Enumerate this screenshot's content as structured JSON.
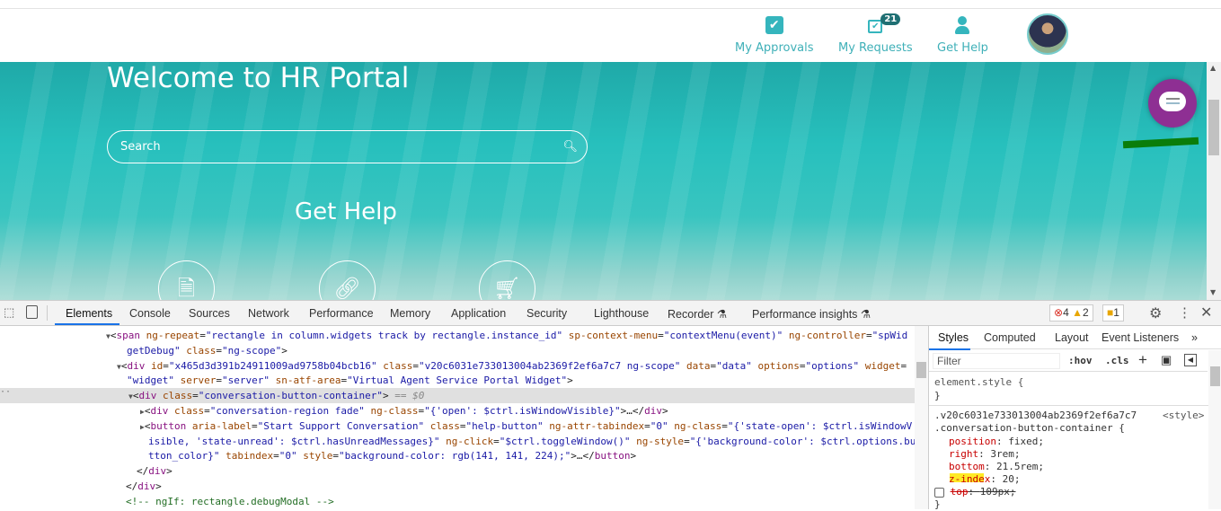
{
  "header": {
    "nav": [
      {
        "label": "My Approvals",
        "icon": "check-square-icon"
      },
      {
        "label": "My Requests",
        "icon": "requests-icon",
        "badge": "21"
      },
      {
        "label": "Get Help",
        "icon": "user-icon"
      }
    ]
  },
  "hero": {
    "title": "Welcome to HR Portal",
    "search_placeholder": "Search",
    "section_title": "Get Help"
  },
  "devtools": {
    "tabs": [
      "Elements",
      "Console",
      "Sources",
      "Network",
      "Performance",
      "Memory",
      "Application",
      "Security",
      "Lighthouse",
      "Recorder",
      "Performance insights"
    ],
    "active_tab": "Elements",
    "errors": "4",
    "warnings": "2",
    "issues": "1",
    "elements_lines": [
      {
        "indent": 118,
        "tri": "▼",
        "segs": [
          [
            "p",
            "<"
          ],
          [
            "t",
            "span "
          ],
          [
            "a",
            "ng-repeat"
          ],
          [
            "p",
            "="
          ],
          [
            "v",
            "\"rectangle in column.widgets track by rectangle.instance_id\" "
          ],
          [
            "a",
            "sp-context-menu"
          ],
          [
            "p",
            "="
          ],
          [
            "v",
            "\"contextMenu(event)\" "
          ],
          [
            "a",
            "ng-controller"
          ],
          [
            "p",
            "="
          ],
          [
            "v",
            "\"spWid"
          ]
        ]
      },
      {
        "indent": 141,
        "tri": "",
        "segs": [
          [
            "v",
            "getDebug\" "
          ],
          [
            "a",
            "class"
          ],
          [
            "p",
            "="
          ],
          [
            "v",
            "\"ng-scope\""
          ],
          [
            "p",
            ">"
          ]
        ]
      },
      {
        "indent": 130,
        "tri": "▼",
        "segs": [
          [
            "p",
            "<"
          ],
          [
            "t",
            "div "
          ],
          [
            "a",
            "id"
          ],
          [
            "p",
            "="
          ],
          [
            "v",
            "\"x465d3d391b24911009ad9758b04bcb16\" "
          ],
          [
            "a",
            "class"
          ],
          [
            "p",
            "="
          ],
          [
            "v",
            "\"v20c6031e733013004ab2369f2ef6a7c7 ng-scope\" "
          ],
          [
            "a",
            "data"
          ],
          [
            "p",
            "="
          ],
          [
            "v",
            "\"data\" "
          ],
          [
            "a",
            "options"
          ],
          [
            "p",
            "="
          ],
          [
            "v",
            "\"options\" "
          ],
          [
            "a",
            "widget"
          ],
          [
            "p",
            "="
          ]
        ]
      },
      {
        "indent": 141,
        "tri": "",
        "segs": [
          [
            "v",
            "\"widget\" "
          ],
          [
            "a",
            "server"
          ],
          [
            "p",
            "="
          ],
          [
            "v",
            "\"server\" "
          ],
          [
            "a",
            "sn-atf-area"
          ],
          [
            "p",
            "="
          ],
          [
            "v",
            "\"Virtual Agent Service Portal Widget\""
          ],
          [
            "p",
            ">"
          ]
        ]
      },
      {
        "indent": 143,
        "tri": "▼",
        "sel": true,
        "segs": [
          [
            "p",
            "<"
          ],
          [
            "t",
            "div "
          ],
          [
            "a",
            "class"
          ],
          [
            "p",
            "="
          ],
          [
            "v",
            "\"conversation-button-container\""
          ],
          [
            "p",
            "> "
          ],
          [
            "s",
            "== $0"
          ]
        ]
      },
      {
        "indent": 156,
        "tri": "▶",
        "segs": [
          [
            "p",
            "<"
          ],
          [
            "t",
            "div "
          ],
          [
            "a",
            "class"
          ],
          [
            "p",
            "="
          ],
          [
            "v",
            "\"conversation-region fade\" "
          ],
          [
            "a",
            "ng-class"
          ],
          [
            "p",
            "="
          ],
          [
            "v",
            "\"{'open': $ctrl.isWindowVisible}\""
          ],
          [
            "p",
            ">…</"
          ],
          [
            "t",
            "div"
          ],
          [
            "p",
            ">"
          ]
        ]
      },
      {
        "indent": 156,
        "tri": "▶",
        "segs": [
          [
            "p",
            "<"
          ],
          [
            "t",
            "button "
          ],
          [
            "a",
            "aria-label"
          ],
          [
            "p",
            "="
          ],
          [
            "v",
            "\"Start Support Conversation\" "
          ],
          [
            "a",
            "class"
          ],
          [
            "p",
            "="
          ],
          [
            "v",
            "\"help-button\" "
          ],
          [
            "a",
            "ng-attr-tabindex"
          ],
          [
            "p",
            "="
          ],
          [
            "v",
            "\"0\" "
          ],
          [
            "a",
            "ng-class"
          ],
          [
            "p",
            "="
          ],
          [
            "v",
            "\"{'state-open': $ctrl.isWindowV"
          ]
        ]
      },
      {
        "indent": 165,
        "tri": "",
        "segs": [
          [
            "v",
            "isible, 'state-unread': $ctrl.hasUnreadMessages}\" "
          ],
          [
            "a",
            "ng-click"
          ],
          [
            "p",
            "="
          ],
          [
            "v",
            "\"$ctrl.toggleWindow()\" "
          ],
          [
            "a",
            "ng-style"
          ],
          [
            "p",
            "="
          ],
          [
            "v",
            "\"{'background-color': $ctrl.options.bu"
          ]
        ]
      },
      {
        "indent": 165,
        "tri": "",
        "segs": [
          [
            "v",
            "tton_color}\" "
          ],
          [
            "a",
            "tabindex"
          ],
          [
            "p",
            "="
          ],
          [
            "v",
            "\"0\" "
          ],
          [
            "a",
            "style"
          ],
          [
            "p",
            "="
          ],
          [
            "v",
            "\"background-color: rgb(141, 141, 224);\""
          ],
          [
            "p",
            ">…</"
          ],
          [
            "t",
            "button"
          ],
          [
            "p",
            ">"
          ]
        ]
      },
      {
        "indent": 152,
        "tri": "",
        "segs": [
          [
            "p",
            "</"
          ],
          [
            "t",
            "div"
          ],
          [
            "p",
            ">"
          ]
        ]
      },
      {
        "indent": 140,
        "tri": "",
        "segs": [
          [
            "p",
            "</"
          ],
          [
            "t",
            "div"
          ],
          [
            "p",
            ">"
          ]
        ]
      },
      {
        "indent": 140,
        "tri": "",
        "segs": [
          [
            "c",
            "<!-- ngIf: rectangle.debugModal -->"
          ]
        ]
      }
    ],
    "styles": {
      "tabs": [
        "Styles",
        "Computed",
        "Layout",
        "Event Listeners",
        "»"
      ],
      "filter_placeholder": "Filter",
      "hov": ":hov",
      "cls": ".cls",
      "plus": "+",
      "element_style": "element.style {",
      "close_brace": "}",
      "selector1": ".v20c6031e733013004ab2369f2ef6a7c7",
      "selector2": ".conversation-button-container {",
      "source": "<style>",
      "props": [
        {
          "name": "position",
          "value": "fixed;"
        },
        {
          "name": "right",
          "value": "3rem;"
        },
        {
          "name": "bottom",
          "value": "21.5rem;"
        },
        {
          "name": "z-index",
          "value": "20;"
        }
      ],
      "disabled_prop": {
        "name": "top",
        "value": "109px"
      }
    }
  }
}
